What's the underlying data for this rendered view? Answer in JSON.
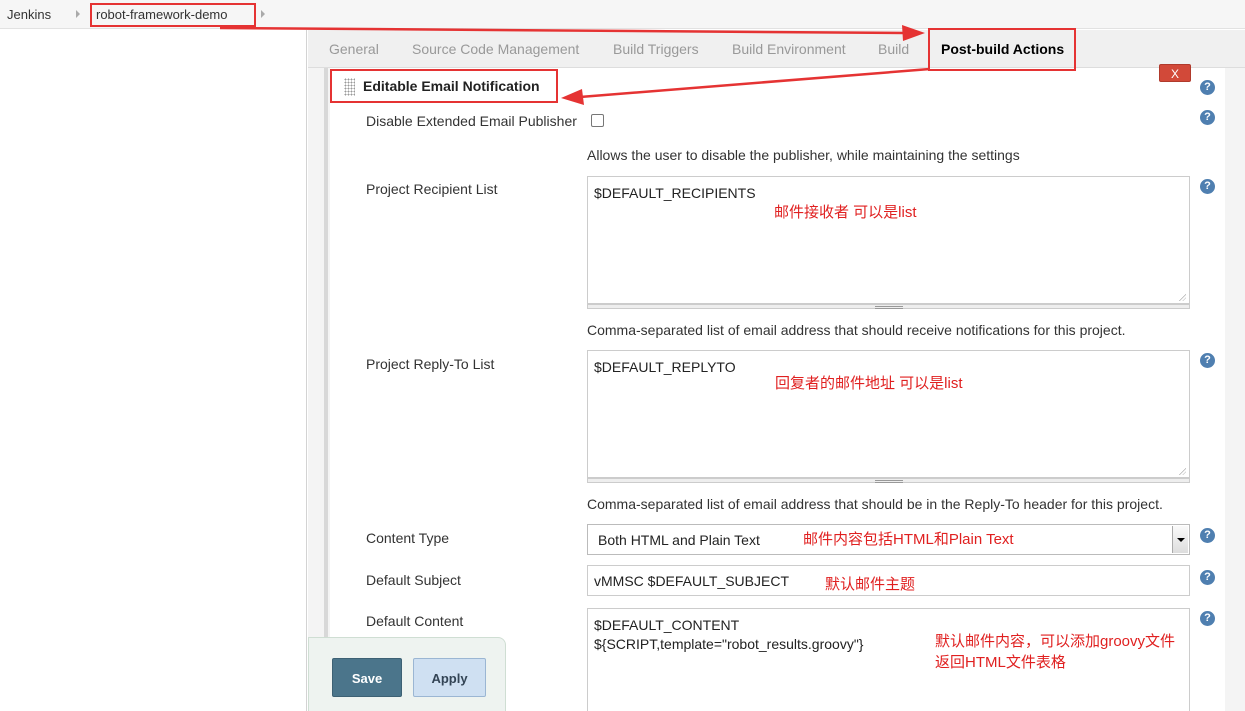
{
  "breadcrumb": {
    "root": "Jenkins",
    "project": "robot-framework-demo"
  },
  "tabs": [
    {
      "label": "General"
    },
    {
      "label": "Source Code Management"
    },
    {
      "label": "Build Triggers"
    },
    {
      "label": "Build Environment"
    },
    {
      "label": "Build"
    },
    {
      "label": "Post-build Actions"
    }
  ],
  "section": {
    "title": "Editable Email Notification",
    "delete_label": "X",
    "help_glyph": "?"
  },
  "form": {
    "disable_publisher": {
      "label": "Disable Extended Email Publisher",
      "checked": false,
      "description": "Allows the user to disable the publisher, while maintaining the settings"
    },
    "recipient_list": {
      "label": "Project Recipient List",
      "value": "$DEFAULT_RECIPIENTS",
      "description": "Comma-separated list of email address that should receive notifications for this project."
    },
    "reply_to_list": {
      "label": "Project Reply-To List",
      "value": "$DEFAULT_REPLYTO",
      "description": "Comma-separated list of email address that should be in the Reply-To header for this project."
    },
    "content_type": {
      "label": "Content Type",
      "value": "Both HTML and Plain Text"
    },
    "default_subject": {
      "label": "Default Subject",
      "value": "vMMSC $DEFAULT_SUBJECT"
    },
    "default_content": {
      "label": "Default Content",
      "value": "$DEFAULT_CONTENT\n${SCRIPT,template=\"robot_results.groovy\"}"
    }
  },
  "annotations": {
    "recipient_note": "邮件接收者   可以是list",
    "reply_to_note": "回复者的邮件地址   可以是list",
    "content_type_note": "邮件内容包括HTML和Plain Text",
    "subject_note": "默认邮件主题",
    "content_note_line1": "默认邮件内容，可以添加groovy文件",
    "content_note_line2": "返回HTML文件表格",
    "color": "#e02020"
  },
  "buttons": {
    "save": "Save",
    "apply": "Apply"
  }
}
